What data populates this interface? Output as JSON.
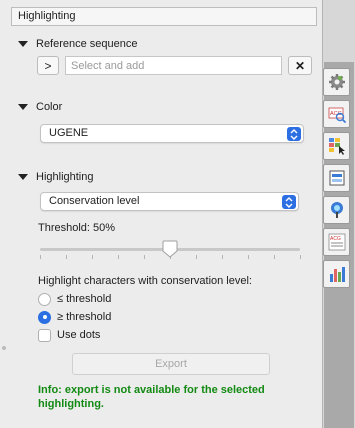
{
  "panel_title": "Highlighting",
  "reference": {
    "header": "Reference sequence",
    "expand_label": ">",
    "placeholder": "Select and add",
    "clear_label": "✕"
  },
  "color": {
    "header": "Color",
    "selected": "UGENE"
  },
  "highlighting": {
    "header": "Highlighting",
    "selected": "Conservation level",
    "threshold_label": "Threshold: 50%",
    "threshold_value": 50,
    "conservation_label": "Highlight characters with conservation level:",
    "option_le": "≤ threshold",
    "option_ge": "≥ threshold",
    "selected_option": "≥ threshold",
    "use_dots": "Use dots",
    "use_dots_checked": false,
    "export_label": "Export",
    "info": "Info: export is not available for the selected highlighting."
  },
  "colors": {
    "accent": "#2b6fe3",
    "info_green": "#138a13"
  },
  "side_tools": [
    "settings-gear-icon",
    "sequence-search-icon",
    "highlighting-icon",
    "alignment-icon",
    "tree-icon",
    "statistics-icon",
    "bar-chart-icon"
  ]
}
